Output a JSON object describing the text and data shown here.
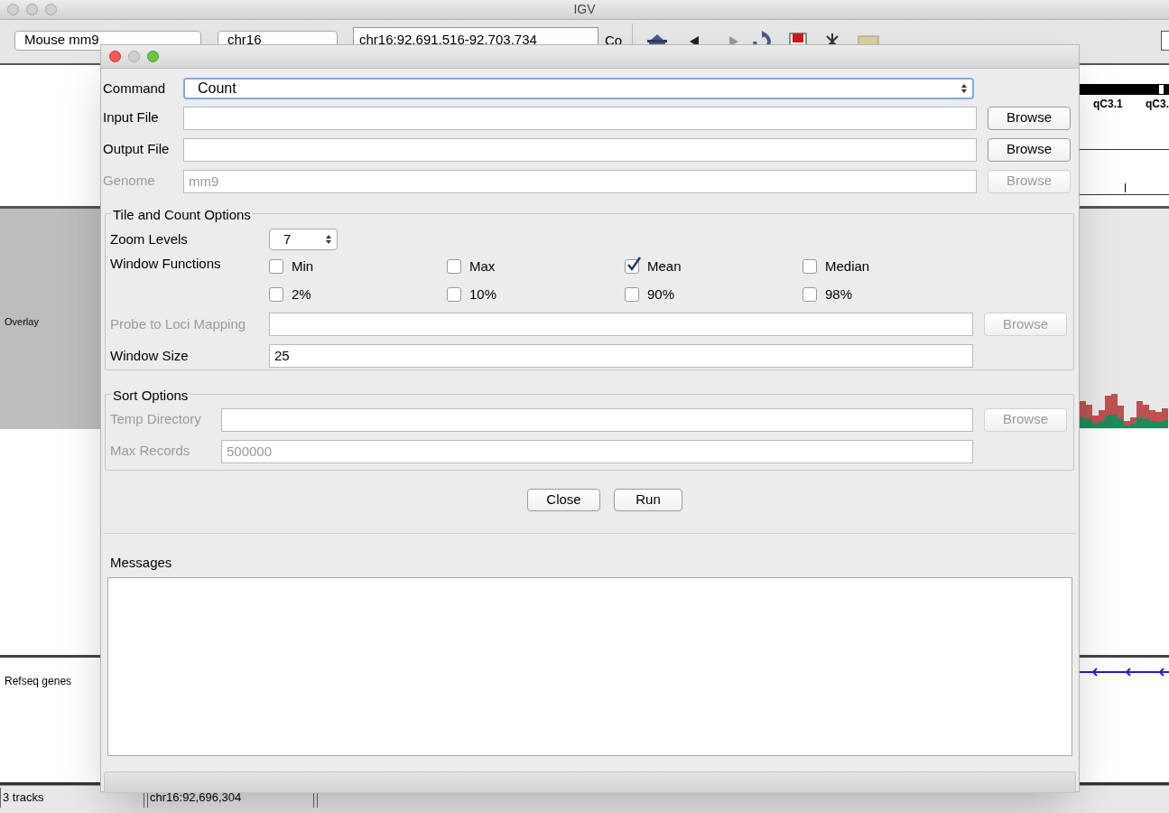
{
  "main_window": {
    "title": "IGV",
    "genome": "Mouse mm9",
    "chromosome": "chr16",
    "locus": "chr16:92,691,516-92,703,734",
    "go_button": "Co",
    "cytobands": [
      "qC3.1",
      "qC3."
    ],
    "tracks": [
      {
        "name": "Overlay",
        "kind": "coverage"
      },
      {
        "name": "Refseq genes",
        "kind": "genes"
      }
    ],
    "status": [
      "3 tracks",
      "chr16:92,696,304"
    ]
  },
  "dialog": {
    "command": {
      "label": "Command",
      "value": "Count"
    },
    "files": [
      {
        "label": "Input File",
        "button": "Browse",
        "disabled": false
      },
      {
        "label": "Output File",
        "button": "Browse",
        "disabled": false
      },
      {
        "label": "Genome",
        "value": "mm9",
        "button": "Browse",
        "disabled": true
      }
    ],
    "tile_options": {
      "title": "Tile and Count Options",
      "zoom_label": "Zoom Levels",
      "zoom_value": "7",
      "functions_label": "Window Functions",
      "functions": [
        {
          "label": "Min",
          "checked": false
        },
        {
          "label": "Max",
          "checked": false
        },
        {
          "label": "Mean",
          "checked": true
        },
        {
          "label": "Median",
          "checked": false
        },
        {
          "label": "2%",
          "checked": false
        },
        {
          "label": "10%",
          "checked": false
        },
        {
          "label": "90%",
          "checked": false
        },
        {
          "label": "98%",
          "checked": false
        }
      ],
      "probe": {
        "label": "Probe to Loci Mapping",
        "button": "Browse",
        "disabled": true
      },
      "window_size": {
        "label": "Window Size",
        "value": "25",
        "disabled": false
      }
    },
    "sort_options": {
      "title": "Sort Options",
      "fields": [
        {
          "label": "Temp Directory",
          "button": "Browse",
          "disabled": true
        },
        {
          "label": "Max Records",
          "value": "500000",
          "disabled": true
        }
      ]
    },
    "buttons": [
      "Close",
      "Run"
    ],
    "messages_label": "Messages"
  }
}
